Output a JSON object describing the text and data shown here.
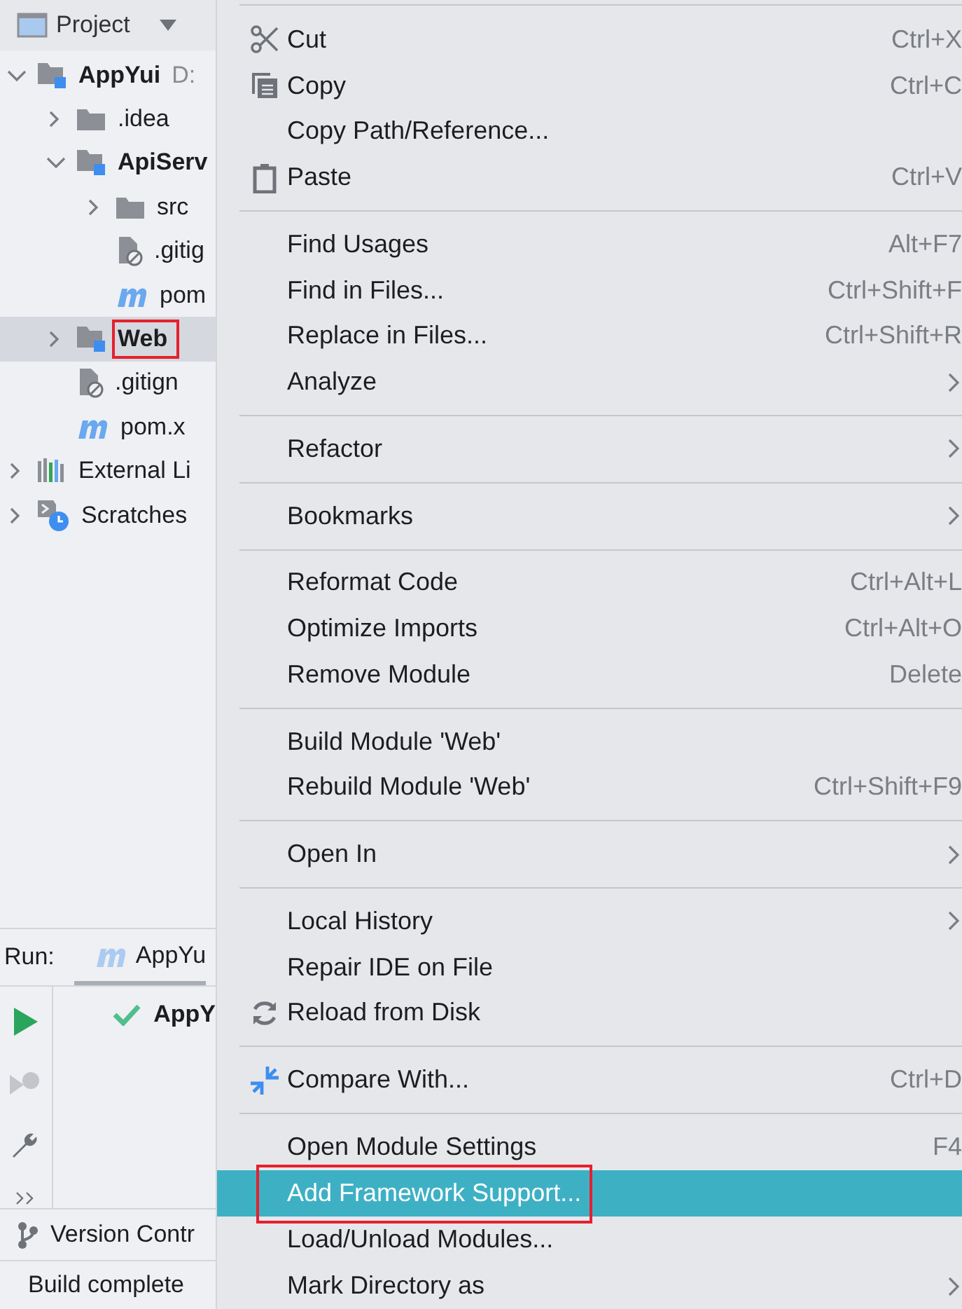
{
  "project_panel": {
    "title": "Project",
    "tree": [
      {
        "label": "AppYui",
        "detail": "D:",
        "kind": "module",
        "expanded": true,
        "selected": false,
        "children": [
          {
            "label": ".idea",
            "kind": "folder",
            "expanded": false,
            "selected": false
          },
          {
            "label": "ApiServ",
            "kind": "module",
            "expanded": true,
            "selected": false,
            "children": [
              {
                "label": "src",
                "kind": "folder",
                "expanded": false,
                "selected": false
              },
              {
                "label": ".gitig",
                "kind": "gitignore",
                "selected": false
              },
              {
                "label": "pom",
                "kind": "maven",
                "selected": false
              }
            ]
          },
          {
            "label": "Web",
            "kind": "module",
            "expanded": false,
            "selected": true,
            "highlighted": true
          },
          {
            "label": ".gitign",
            "kind": "gitignore",
            "selected": false
          },
          {
            "label": "pom.x",
            "kind": "maven",
            "selected": false
          }
        ]
      },
      {
        "label": "External Li",
        "kind": "libraries",
        "expanded": false,
        "selected": false
      },
      {
        "label": "Scratches",
        "kind": "scratches",
        "expanded": false,
        "selected": false
      }
    ]
  },
  "run_panel": {
    "label": "Run:",
    "tab": "AppYu",
    "entry": "AppY"
  },
  "version_control": "Version Contr",
  "status_bar": "Build complete",
  "context_menu": [
    {
      "kind": "separator"
    },
    {
      "kind": "cut",
      "label": "Cut",
      "shortcut": "Ctrl+X",
      "selected": false
    },
    {
      "kind": "copy",
      "label": "Copy",
      "shortcut": "Ctrl+C",
      "selected": false
    },
    {
      "kind": "plain",
      "label": "Copy Path/Reference...",
      "selected": false
    },
    {
      "kind": "paste",
      "label": "Paste",
      "shortcut": "Ctrl+V",
      "selected": false
    },
    {
      "kind": "separator"
    },
    {
      "kind": "plain",
      "label": "Find Usages",
      "shortcut": "Alt+F7",
      "selected": false
    },
    {
      "kind": "plain",
      "label": "Find in Files...",
      "shortcut": "Ctrl+Shift+F",
      "selected": false
    },
    {
      "kind": "plain",
      "label": "Replace in Files...",
      "shortcut": "Ctrl+Shift+R",
      "selected": false
    },
    {
      "kind": "plain",
      "label": "Analyze",
      "submenu": true,
      "selected": false
    },
    {
      "kind": "separator"
    },
    {
      "kind": "plain",
      "label": "Refactor",
      "submenu": true,
      "selected": false
    },
    {
      "kind": "separator"
    },
    {
      "kind": "plain",
      "label": "Bookmarks",
      "submenu": true,
      "selected": false
    },
    {
      "kind": "separator"
    },
    {
      "kind": "plain",
      "label": "Reformat Code",
      "shortcut": "Ctrl+Alt+L",
      "selected": false
    },
    {
      "kind": "plain",
      "label": "Optimize Imports",
      "shortcut": "Ctrl+Alt+O",
      "selected": false
    },
    {
      "kind": "plain",
      "label": "Remove Module",
      "shortcut": "Delete",
      "selected": false
    },
    {
      "kind": "separator"
    },
    {
      "kind": "plain",
      "label": "Build Module 'Web'",
      "selected": false
    },
    {
      "kind": "plain",
      "label": "Rebuild Module 'Web'",
      "shortcut": "Ctrl+Shift+F9",
      "selected": false
    },
    {
      "kind": "separator"
    },
    {
      "kind": "plain",
      "label": "Open In",
      "submenu": true,
      "selected": false
    },
    {
      "kind": "separator"
    },
    {
      "kind": "plain",
      "label": "Local History",
      "submenu": true,
      "selected": false
    },
    {
      "kind": "plain",
      "label": "Repair IDE on File",
      "selected": false
    },
    {
      "kind": "reload",
      "label": "Reload from Disk",
      "selected": false
    },
    {
      "kind": "separator"
    },
    {
      "kind": "compare",
      "label": "Compare With...",
      "shortcut": "Ctrl+D",
      "selected": false
    },
    {
      "kind": "separator"
    },
    {
      "kind": "plain",
      "label": "Open Module Settings",
      "shortcut": "F4",
      "selected": false
    },
    {
      "kind": "plain",
      "label": "Add Framework Support...",
      "selected": true,
      "highlighted": true
    },
    {
      "kind": "plain",
      "label": "Load/Unload Modules...",
      "selected": false
    },
    {
      "kind": "plain",
      "label": "Mark Directory as",
      "submenu": true,
      "selected": false
    }
  ]
}
